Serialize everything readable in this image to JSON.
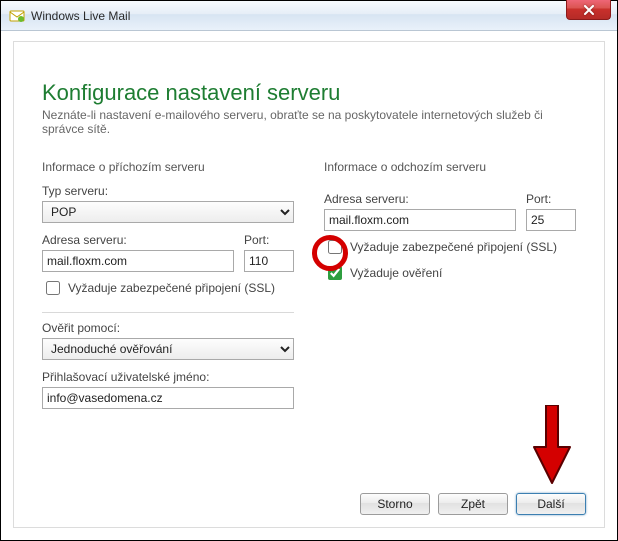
{
  "window": {
    "title": "Windows Live Mail",
    "close_aria": "Close"
  },
  "page": {
    "title": "Konfigurace nastavení serveru",
    "subtitle": "Neznáte-li nastavení e-mailového serveru, obraťte se na poskytovatele internetových služeb či správce sítě."
  },
  "incoming": {
    "section": "Informace o příchozím serveru",
    "type_label": "Typ serveru:",
    "type_value": "POP",
    "addr_label": "Adresa serveru:",
    "addr_value": "mail.floxm.com",
    "port_label": "Port:",
    "port_value": "110",
    "ssl_label": "Vyžaduje zabezpečené připojení (SSL)",
    "ssl_checked": false,
    "auth_label": "Ověřit pomocí:",
    "auth_value": "Jednoduché ověřování",
    "login_label": "Přihlašovací uživatelské jméno:",
    "login_value": "info@vasedomena.cz"
  },
  "outgoing": {
    "section": "Informace o odchozím serveru",
    "addr_label": "Adresa serveru:",
    "addr_value": "mail.floxm.com",
    "port_label": "Port:",
    "port_value": "25",
    "ssl_label": "Vyžaduje zabezpečené připojení (SSL)",
    "ssl_checked": false,
    "auth_label": "Vyžaduje ověření",
    "auth_checked": true
  },
  "buttons": {
    "cancel": "Storno",
    "back": "Zpět",
    "next": "Další"
  }
}
